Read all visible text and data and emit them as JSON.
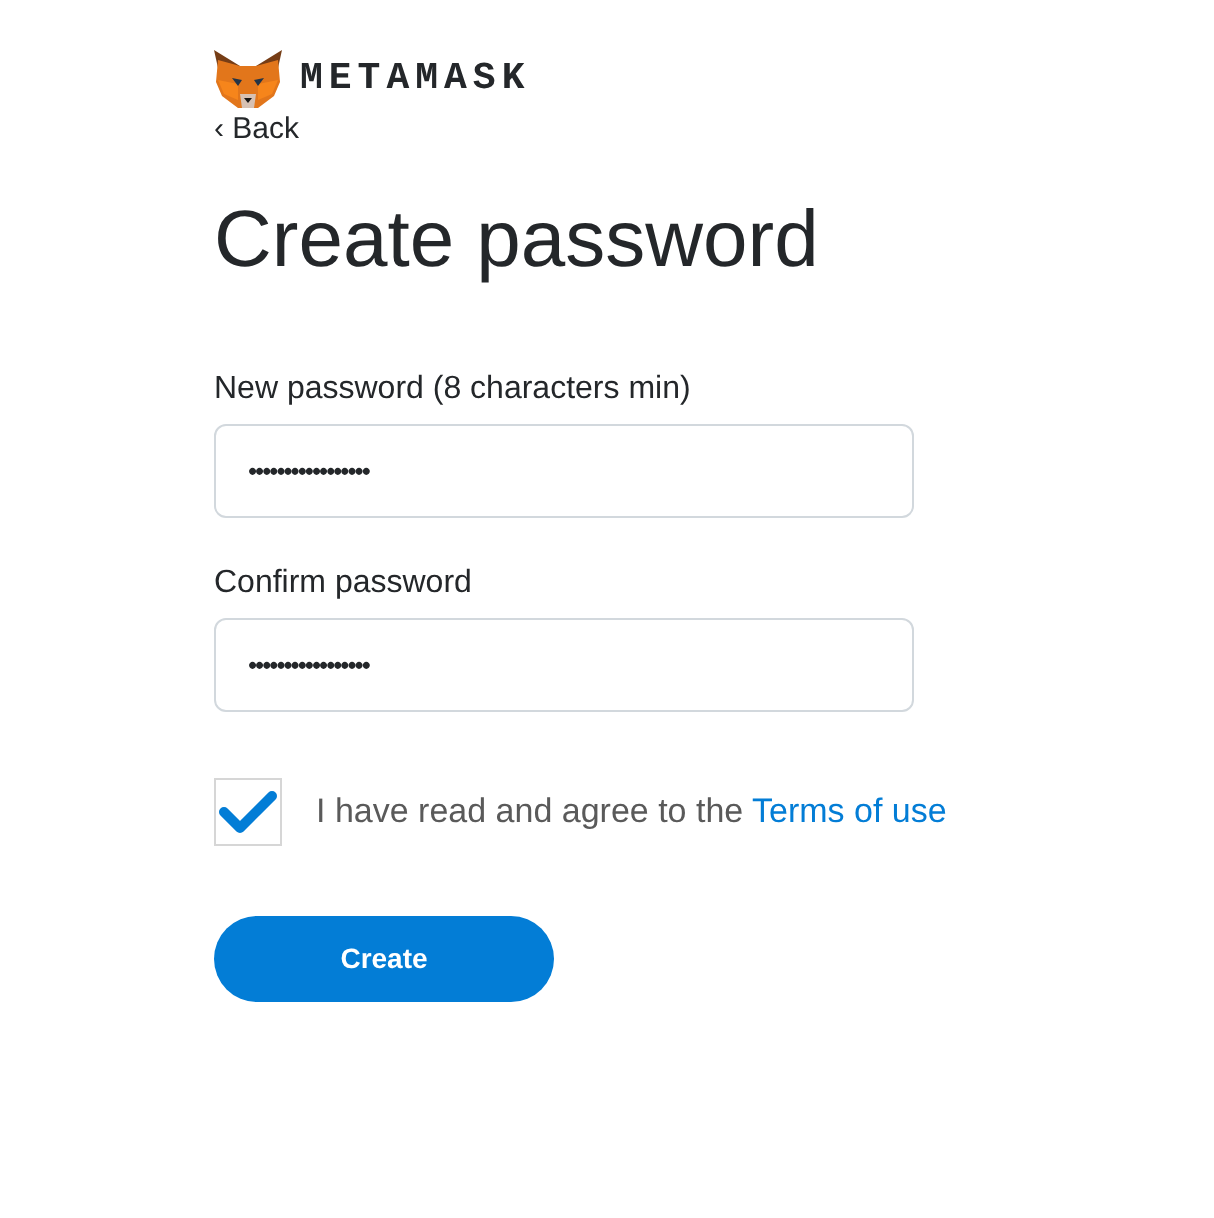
{
  "header": {
    "brand": "METAMASK",
    "back_link": "‹ Back"
  },
  "title": "Create password",
  "fields": [
    {
      "label": "New password (8 characters min)",
      "value": "•••••••••••••••••"
    },
    {
      "label": "Confirm password",
      "value": "•••••••••••••••••"
    }
  ],
  "agreement": {
    "checked": true,
    "text": "I have read and agree to the",
    "link": "Terms of use"
  },
  "buttons": [
    {
      "label": "Create"
    }
  ]
}
